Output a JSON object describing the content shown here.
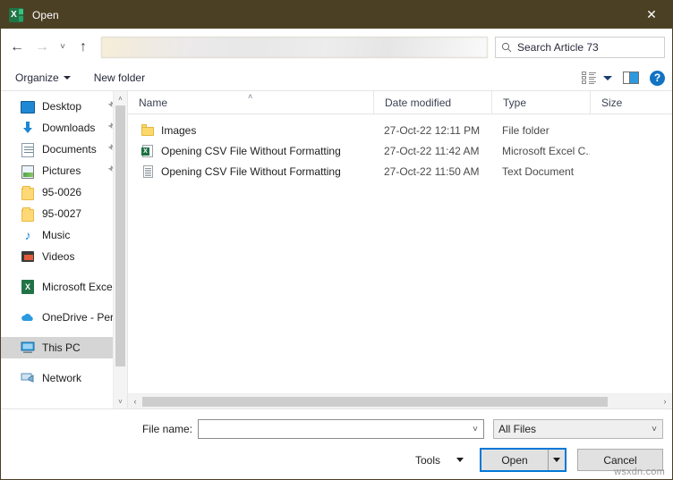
{
  "window": {
    "title": "Open",
    "app_icon": "excel-icon",
    "close_label": "✕",
    "titlebar_color": "#4c4024"
  },
  "nav": {
    "back": "←",
    "forward": "→",
    "recent": "˅",
    "up": "↑",
    "address_value": ""
  },
  "search": {
    "icon": "search-icon",
    "value": "Search Article 73",
    "placeholder": "Search Article 73"
  },
  "toolbar": {
    "organize_label": "Organize",
    "new_folder_label": "New folder",
    "view_icon": "view-options-icon",
    "preview_pane_icon": "preview-pane-icon",
    "help_label": "?"
  },
  "sidebar": {
    "items": [
      {
        "label": "Desktop",
        "icon": "desktop-icon",
        "pinned": true,
        "selected": false
      },
      {
        "label": "Downloads",
        "icon": "download-icon",
        "pinned": true,
        "selected": false
      },
      {
        "label": "Documents",
        "icon": "document-icon",
        "pinned": true,
        "selected": false
      },
      {
        "label": "Pictures",
        "icon": "pictures-icon",
        "pinned": true,
        "selected": false
      },
      {
        "label": "95-0026",
        "icon": "folder-icon",
        "pinned": false,
        "selected": false
      },
      {
        "label": "95-0027",
        "icon": "folder-icon",
        "pinned": false,
        "selected": false
      },
      {
        "label": "Music",
        "icon": "music-icon",
        "pinned": false,
        "selected": false
      },
      {
        "label": "Videos",
        "icon": "video-icon",
        "pinned": false,
        "selected": false
      },
      {
        "label": "Microsoft Excel",
        "icon": "excel-icon",
        "pinned": false,
        "selected": false
      },
      {
        "label": "OneDrive - Person",
        "icon": "onedrive-icon",
        "pinned": false,
        "selected": false
      },
      {
        "label": "This PC",
        "icon": "this-pc-icon",
        "pinned": false,
        "selected": true
      },
      {
        "label": "Network",
        "icon": "network-icon",
        "pinned": false,
        "selected": false
      }
    ],
    "pin_glyph": "📌",
    "scroll_up": "˄",
    "scroll_down": "˅"
  },
  "filelist": {
    "columns": [
      "Name",
      "Date modified",
      "Type",
      "Size"
    ],
    "sort_column": "Name",
    "sort_caret": "˄",
    "rows": [
      {
        "name": "Images",
        "date_modified": "27-Oct-22 12:11 PM",
        "type": "File folder",
        "size": "",
        "icon": "folder-icon"
      },
      {
        "name": "Opening CSV File Without Formatting",
        "date_modified": "27-Oct-22 11:42 AM",
        "type": "Microsoft Excel C...",
        "size": "",
        "icon": "excel-csv-icon"
      },
      {
        "name": "Opening CSV File Without Formatting",
        "date_modified": "27-Oct-22 11:50 AM",
        "type": "Text Document",
        "size": "",
        "icon": "text-document-icon"
      }
    ],
    "hscroll_left": "‹",
    "hscroll_right": "›"
  },
  "footer": {
    "filename_label": "File name:",
    "filename_value": "",
    "filename_placeholder": "",
    "filter_value": "All Files",
    "tools_label": "Tools",
    "open_label": "Open",
    "cancel_label": "Cancel",
    "chevron": "˅"
  },
  "watermark": {
    "text": "wsxdn.com"
  },
  "colors": {
    "titlebar": "#4c4024",
    "focus_ring": "#0078d7",
    "selection": "#d5d5d5",
    "help_blue": "#1273c4",
    "excel_green": "#217346"
  }
}
